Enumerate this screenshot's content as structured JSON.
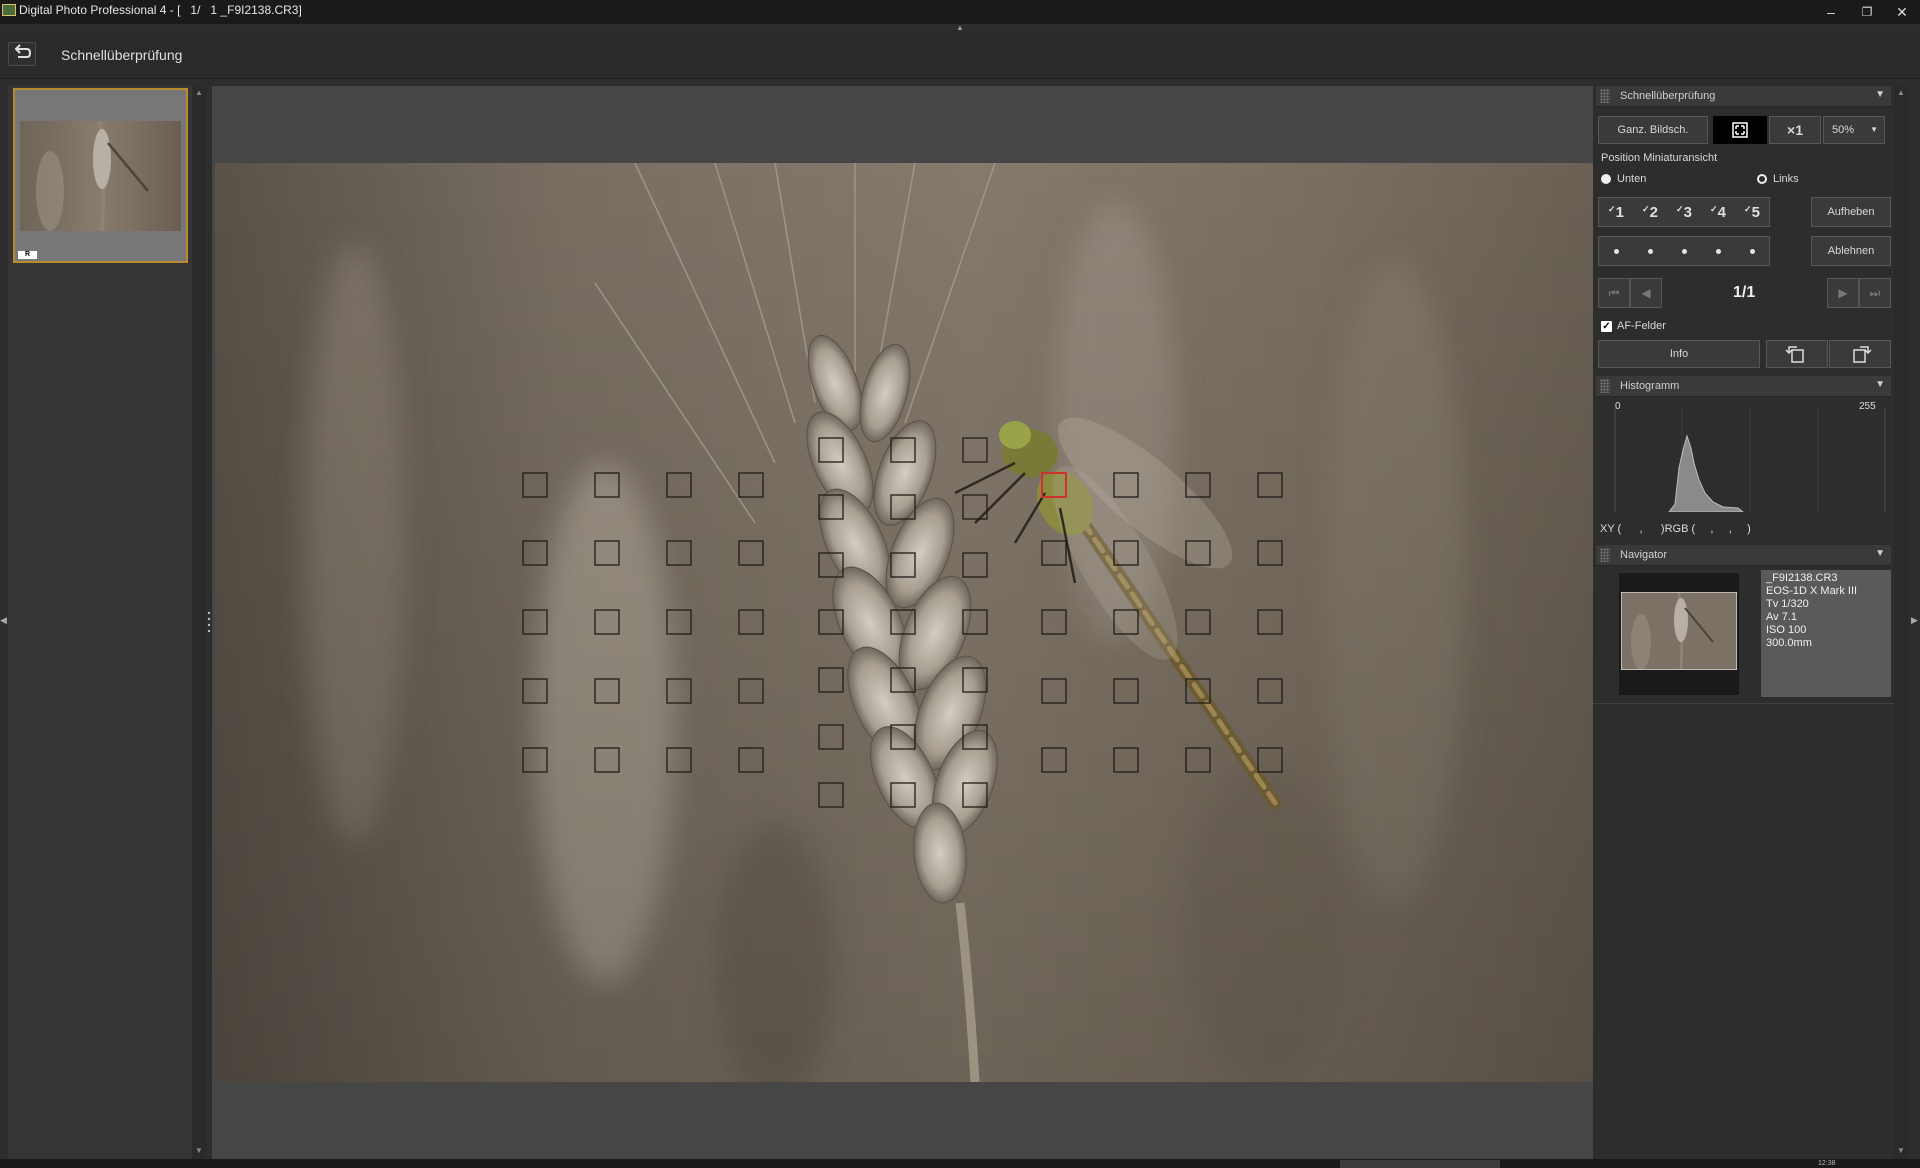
{
  "window": {
    "title": "Digital Photo Professional 4 - [   1/   1 _F9I2138.CR3]",
    "minimize_glyph": "–",
    "restore_glyph": "❐",
    "close_glyph": "✕"
  },
  "toolbar": {
    "title": "Schnellüberprüfung",
    "back_icon": "undo-arrow-icon"
  },
  "filmstrip": {
    "items": [
      {
        "badge": "R",
        "selected": true
      }
    ]
  },
  "quick_check_panel": {
    "title": "Schnellüberprüfung",
    "fullscreen_label": "Ganz. Bildsch.",
    "fit_icon": "fit-to-screen-icon",
    "zoom_1x_label": "×1",
    "zoom_value": "50%",
    "position_label": "Position Miniaturansicht",
    "position_options": [
      {
        "label": "Unten",
        "selected": true
      },
      {
        "label": "Links",
        "selected": false
      }
    ],
    "ratings": [
      "1",
      "2",
      "3",
      "4",
      "5"
    ],
    "rating_check": "✓",
    "clear_label": "Aufheben",
    "reject_label": "Ablehnen",
    "page_indicator": "1/1",
    "af_points_label": "AF-Felder",
    "af_points_checked": true,
    "info_label": "Info",
    "rotate_left_icon": "rotate-left-icon",
    "rotate_right_icon": "rotate-right-icon"
  },
  "histogram_panel": {
    "title": "Histogramm",
    "min_label": "0",
    "max_label": "255",
    "readout": "XY (      ,      )RGB (     ,     ,     )"
  },
  "navigator_panel": {
    "title": "Navigator",
    "filename": "_F9I2138.CR3",
    "camera": "EOS-1D X Mark III",
    "shutter": "Tv 1/320",
    "aperture": "Av 7.1",
    "iso": "ISO 100",
    "focal_length": "300.0mm"
  },
  "statusbar": {
    "clock": "12:38"
  },
  "colors": {
    "selection_border": "#b88b2e",
    "active_af_point": "#d03030"
  }
}
